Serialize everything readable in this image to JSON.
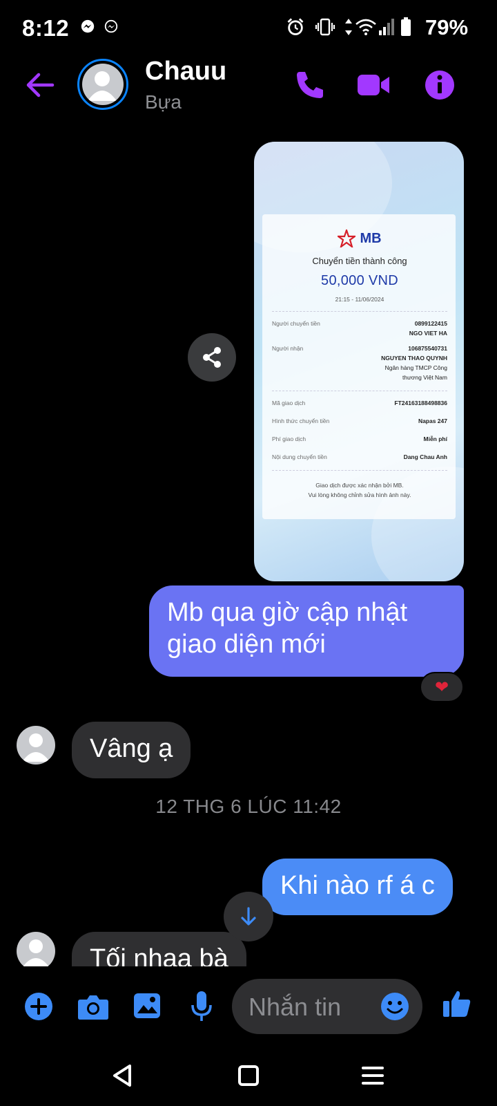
{
  "status_bar": {
    "time": "8:12",
    "battery": "79%",
    "icons": [
      "messenger-icon",
      "messenger-icon",
      "alarm-icon",
      "vibrate-icon",
      "data-arrows-icon",
      "wifi-icon",
      "signal-icon",
      "battery-icon"
    ]
  },
  "header": {
    "name": "Chauu",
    "subtitle": "Bựa",
    "accent": "#a238ff",
    "icons": [
      "back-arrow-icon",
      "phone-icon",
      "video-icon",
      "info-icon"
    ]
  },
  "receipt": {
    "bank": "MB",
    "title": "Chuyển tiền thành công",
    "amount": "50,000 VND",
    "datetime": "21:15 - 11/06/2024",
    "sender_label": "Người chuyển tiền",
    "sender_account": "0899122415",
    "sender_name": "NGO VIET HA",
    "receiver_label": "Người nhận",
    "receiver_account": "106875540731",
    "receiver_name": "NGUYEN THAO QUYNH",
    "receiver_bank_line1": "Ngân hàng TMCP Công",
    "receiver_bank_line2": "thương Việt Nam",
    "txn_label": "Mã giao dịch",
    "txn_value": "FT24163188498836",
    "method_label": "Hình thức chuyển tiền",
    "method_value": "Napas 247",
    "fee_label": "Phí giao dịch",
    "fee_value": "Miễn phí",
    "content_label": "Nội dung chuyển tiền",
    "content_value": "Dang Chau Anh",
    "footer_line1": "Giao dịch được xác nhận bởi MB.",
    "footer_line2": "Vui lòng không chỉnh sửa hình ảnh này."
  },
  "messages": {
    "out1": "Mb qua giờ cập nhật giao diện mới",
    "reaction": "❤",
    "in1": "Vâng ạ",
    "timestamp": "12 THG 6 LÚC 11:42",
    "out2": "Khi nào rf á c",
    "in2": "Tối nhaa bà"
  },
  "composer": {
    "placeholder": "Nhắn tin",
    "icons": [
      "plus-icon",
      "camera-icon",
      "gallery-icon",
      "mic-icon",
      "emoji-icon",
      "like-icon"
    ],
    "icon_color": "#3d8bf7"
  },
  "nav": {
    "icons": [
      "back-icon",
      "home-icon",
      "recents-icon"
    ]
  }
}
